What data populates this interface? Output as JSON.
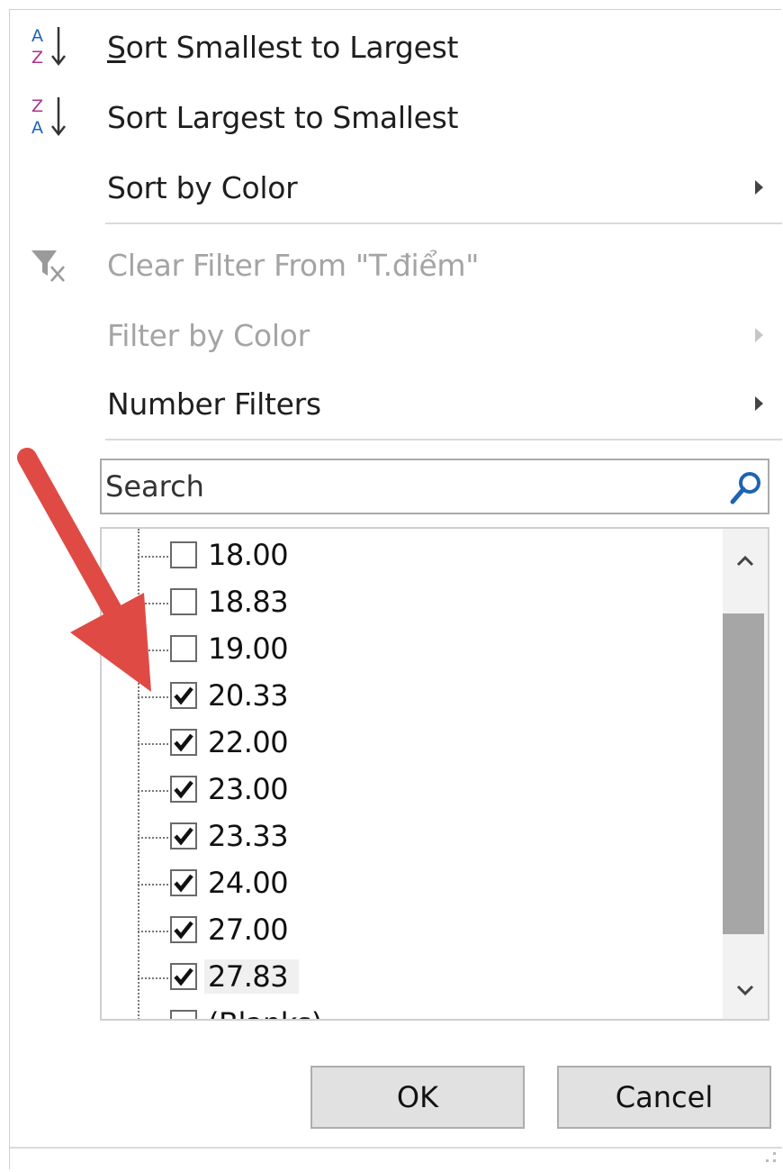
{
  "menu": {
    "sort_asc": "Sort Smallest to Largest",
    "sort_desc": "Sort Largest to Smallest",
    "sort_by_color": "Sort by Color",
    "clear_filter": "Clear Filter From \"T.điểm\"",
    "filter_by_color": "Filter by Color",
    "number_filters": "Number Filters"
  },
  "search": {
    "placeholder": "Search"
  },
  "list": {
    "items": [
      {
        "value": "18.00",
        "checked": false
      },
      {
        "value": "18.83",
        "checked": false
      },
      {
        "value": "19.00",
        "checked": false
      },
      {
        "value": "20.33",
        "checked": true
      },
      {
        "value": "22.00",
        "checked": true
      },
      {
        "value": "23.00",
        "checked": true
      },
      {
        "value": "23.33",
        "checked": true
      },
      {
        "value": "24.00",
        "checked": true
      },
      {
        "value": "27.00",
        "checked": true
      },
      {
        "value": "27.83",
        "checked": true
      },
      {
        "value": "(Blanks)",
        "checked": false
      }
    ]
  },
  "buttons": {
    "ok": "OK",
    "cancel": "Cancel"
  },
  "icons": {
    "sort_asc": "sort-az-icon",
    "sort_desc": "sort-za-icon",
    "clear_filter": "clear-filter-icon",
    "search": "search-icon",
    "submenu": "chevron-right-icon"
  },
  "colors": {
    "annotation_arrow": "#e04a45",
    "sort_icon_accent": "#b0308c",
    "search_icon": "#1e63b4"
  }
}
